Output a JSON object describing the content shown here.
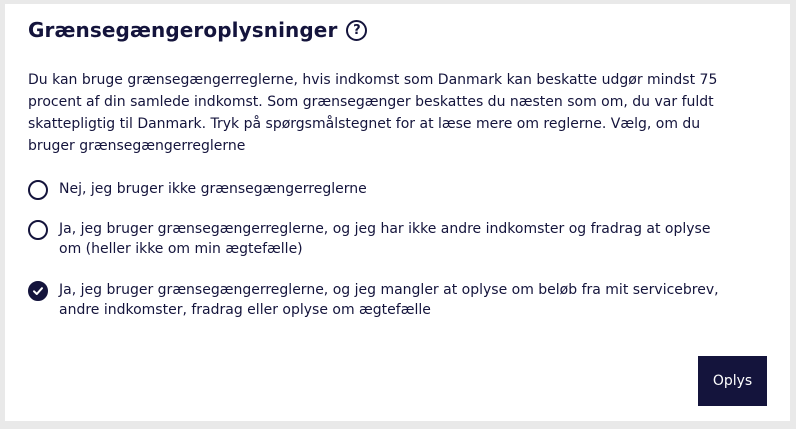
{
  "section": {
    "title": "Grænsegængeroplysninger",
    "help_icon": "question-mark",
    "description": "Du kan bruge grænsegængerreglerne, hvis indkomst som Danmark kan beskatte udgør mindst 75 procent af din samlede indkomst. Som grænsegænger beskattes du næsten som om, du var fuldt skattepligtig til Danmark. Tryk på spørgsmålstegnet for at læse mere om reglerne. Vælg, om du bruger grænsegængerreglerne"
  },
  "options": [
    {
      "label": "Nej, jeg bruger ikke grænsegængerreglerne",
      "checked": false
    },
    {
      "label": "Ja, jeg bruger grænsegængerreglerne, og jeg har ikke andre indkomster og fradrag at oplyse om (heller ikke om min ægtefælle)",
      "checked": false
    },
    {
      "label": "Ja, jeg bruger grænsegængerreglerne, og jeg mangler at oplyse om beløb fra mit servicebrev, andre indkomster, fradrag eller oplyse om ægtefælle",
      "checked": true
    }
  ],
  "actions": {
    "submit_label": "Oplys"
  },
  "colors": {
    "primary": "#14143c",
    "background": "#e9e9e9",
    "card": "#ffffff"
  }
}
